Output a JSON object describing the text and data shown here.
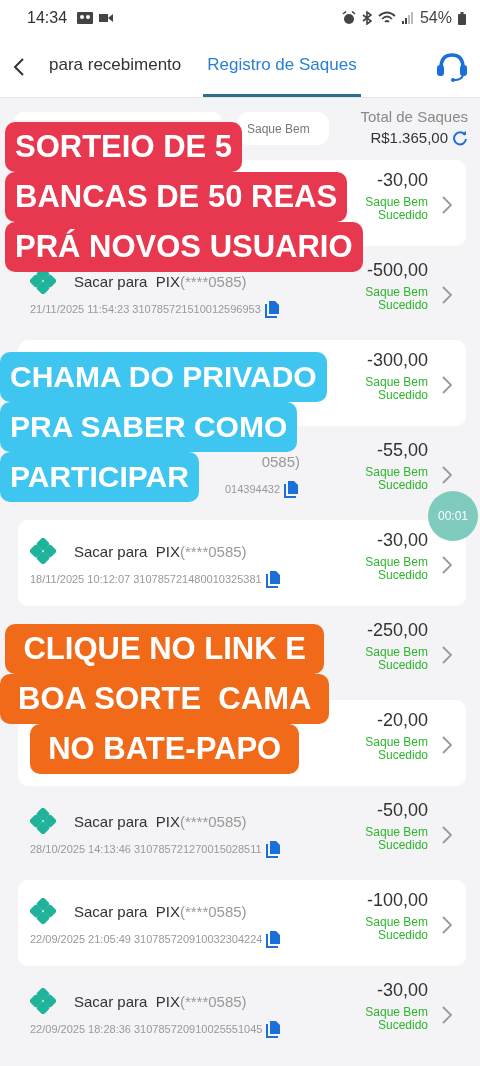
{
  "status_bar": {
    "time": "14:34",
    "battery": "54%"
  },
  "tabs": [
    {
      "label": "para recebimento",
      "selected": false
    },
    {
      "label": "Registro de Saques",
      "selected": true
    }
  ],
  "filter": {
    "value": "Saque Bem"
  },
  "total": {
    "label": "Total de Saques",
    "value": "R$1.365,00"
  },
  "rows": [
    {
      "amount": "-30,00",
      "status": "Saque Bem Sucedido"
    },
    {
      "title": "Sacar para  PIX",
      "masked": "(****0585)",
      "meta": "21/11/2025 11:54:23 310785721510012596953",
      "amount": "-500,00",
      "status": "Saque Bem Sucedido"
    },
    {
      "amount": "-300,00",
      "status": "Saque Bem Sucedido"
    },
    {
      "masked": "0585)",
      "meta": "014394432",
      "amount": "-55,00",
      "status": "Saque Bem Sucedido"
    },
    {
      "title": "Sacar para  PIX",
      "masked": "(****0585)",
      "meta": "18/11/2025 10:12:07 310785721480010325381",
      "amount": "-30,00",
      "status": "Saque Bem Sucedido"
    },
    {
      "amount": "-250,00",
      "status": "Saque Bem Sucedido"
    },
    {
      "amount": "-20,00",
      "status": "Saque Bem Sucedido"
    },
    {
      "title": "Sacar para  PIX",
      "masked": "(****0585)",
      "meta": "28/10/2025 14:13:46 310785721270015028511",
      "amount": "-50,00",
      "status": "Saque Bem Sucedido"
    },
    {
      "title": "Sacar para  PIX",
      "masked": "(****0585)",
      "meta": "22/09/2025 21:05:49 310785720910032304224",
      "amount": "-100,00",
      "status": "Saque Bem Sucedido"
    },
    {
      "title": "Sacar para  PIX",
      "masked": "(****0585)",
      "meta": "22/09/2025 18:28:36 310785720910025551045",
      "amount": "-30,00",
      "status": "Saque Bem Sucedido"
    }
  ],
  "timer": "00:01",
  "stickers": [
    {
      "lines": [
        "SORTEIO DE 5",
        "BANCAS DE 50 REAS",
        "PRÁ NOVOS USUARIO"
      ],
      "color": "#e8384f"
    },
    {
      "lines": [
        "CHAMA DO PRIVADO",
        "PRA SABER COMO",
        "PARTICIPAR"
      ],
      "color": "#3ec6f0"
    },
    {
      "lines": [
        "CLIQUE NO LINK E",
        "BOA SORTE  CAMA",
        "NO BATE-PAPO"
      ],
      "color": "#f06a1a"
    }
  ]
}
